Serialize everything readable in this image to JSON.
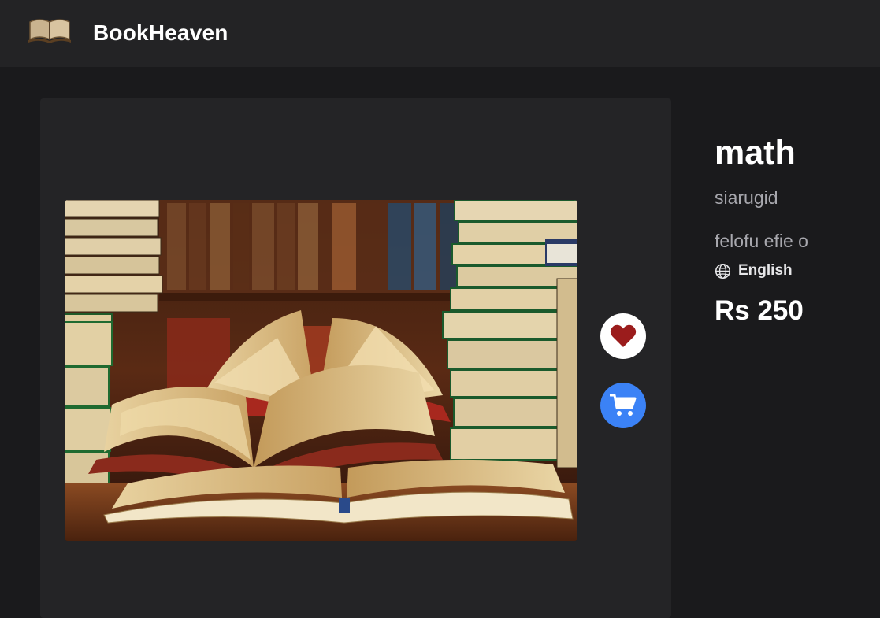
{
  "navbar": {
    "logo_icon": "open-book-icon",
    "brand": "BookHeaven"
  },
  "book": {
    "image_icon": "book-cover-image",
    "title": "math",
    "author": "siarugid",
    "publisher": "felofu efie o",
    "language_icon": "globe-icon",
    "language": "English",
    "price": "Rs 250"
  },
  "actions": {
    "favourite_icon": "heart-icon",
    "cart_icon": "cart-icon"
  },
  "colors": {
    "navbar_bg": "#232325",
    "page_bg": "#1a1a1c",
    "card_bg": "#242426",
    "heart": "#9b1c1c",
    "cart_bg": "#3b82f6",
    "muted_text": "#a8a8ae"
  }
}
